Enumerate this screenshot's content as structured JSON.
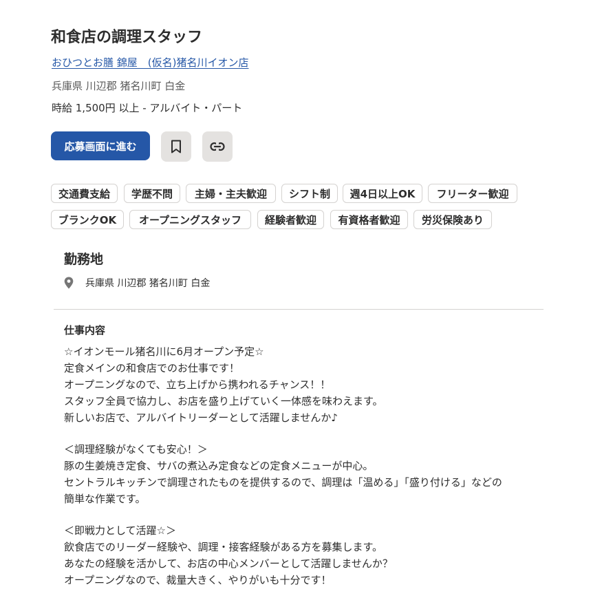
{
  "job": {
    "title": "和食店の調理スタッフ",
    "company": "おひつとお膳 錦屋　(仮名)猪名川イオン店",
    "location": "兵庫県 川辺郡 猪名川町 白金",
    "salary": "時給 1,500円 以上  - アルバイト・パート"
  },
  "actions": {
    "apply_label": "応募画面に進む",
    "save_icon": "bookmark-icon",
    "copy_icon": "link-icon"
  },
  "tags": [
    "交通費支給",
    "学歴不問",
    "主婦・主夫歓迎",
    "シフト制",
    "週4日以上OK",
    "フリーター歓迎",
    "ブランクOK",
    "オープニングスタッフ",
    "経験者歓迎",
    "有資格者歓迎",
    "労災保険あり"
  ],
  "work_location": {
    "heading": "勤務地",
    "icon": "location-pin-icon",
    "address": "兵庫県 川辺郡 猪名川町 白金"
  },
  "job_description": {
    "heading": "仕事内容",
    "lines": [
      "☆イオンモール猪名川に6月オープン予定☆",
      "定食メインの和食店でのお仕事です！",
      "オープニングなので、立ち上げから携われるチャンス！！",
      "スタッフ全員で協力し、お店を盛り上げていく一体感を味わえます。",
      "新しいお店で、アルバイトリーダーとして活躍しませんか♪",
      "",
      "＜調理経験がなくても安心！＞",
      "豚の生姜焼き定食、サバの煮込み定食などの定食メニューが中心。",
      "セントラルキッチンで調理されたものを提供するので、調理は「温める」「盛り付ける」などの",
      "簡単な作業です。",
      "",
      "＜即戦力として活躍☆＞",
      "飲食店でのリーダー経験や、調理・接客経験がある方を募集します。",
      "あなたの経験を活かして、お店の中心メンバーとして活躍しませんか？",
      "オープニングなので、裁量大きく、やりがいも十分です！"
    ]
  },
  "colors": {
    "accent": "#2557a7",
    "text": "#2d2d2d",
    "muted": "#595959",
    "icon_button_bg": "#e4e2e0",
    "tag_border": "#d4d2d0"
  }
}
